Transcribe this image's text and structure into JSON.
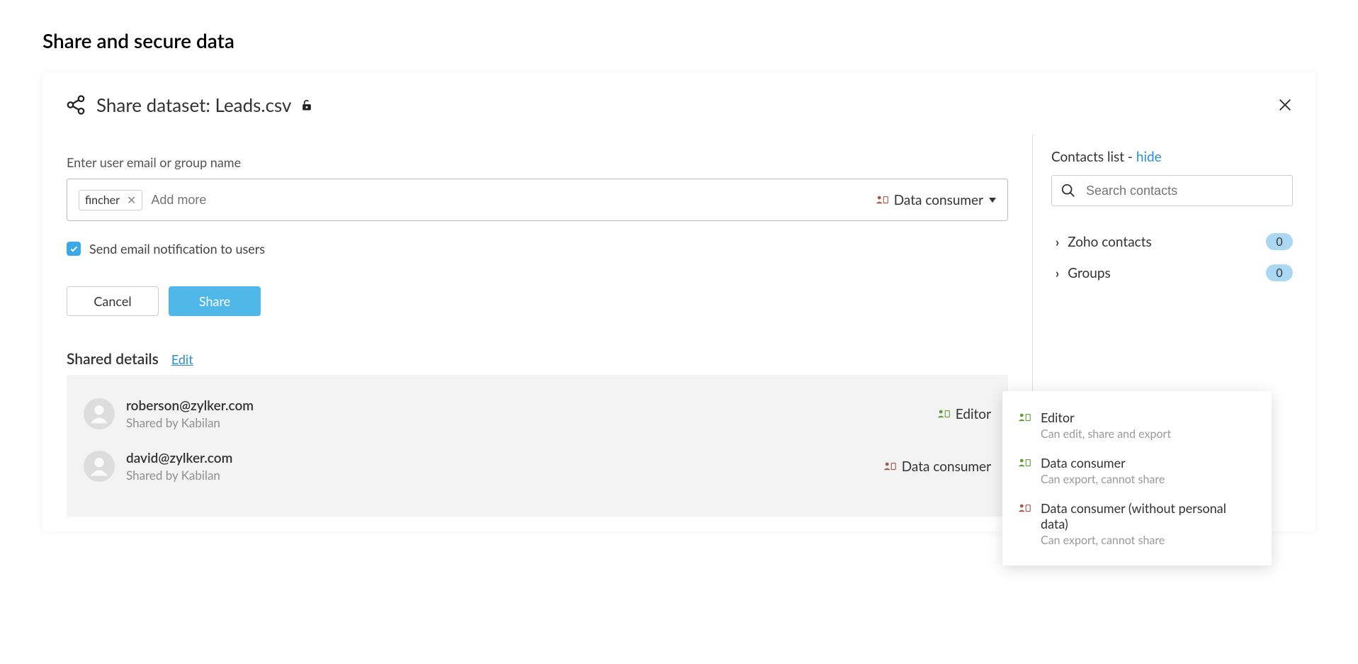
{
  "page": {
    "title": "Share and secure data"
  },
  "modal": {
    "title": "Share dataset: Leads.csv"
  },
  "form": {
    "userFieldLabel": "Enter user email or group name",
    "chip": "fincher",
    "addMorePlaceholder": "Add more",
    "selectedRole": "Data consumer",
    "notifyLabel": "Send email notification to users",
    "cancelLabel": "Cancel",
    "shareLabel": "Share"
  },
  "shared": {
    "headerTitle": "Shared details",
    "editLabel": "Edit",
    "items": [
      {
        "email": "roberson@zylker.com",
        "sharedBy": "Shared by Kabilan",
        "role": "Editor",
        "roleColor": "#6a9b3a"
      },
      {
        "email": "david@zylker.com",
        "sharedBy": "Shared by Kabilan",
        "role": "Data consumer",
        "roleColor": "#a55a4a"
      }
    ]
  },
  "contacts": {
    "headerPrefix": "Contacts list - ",
    "hideLabel": "hide",
    "searchPlaceholder": "Search contacts",
    "groups": [
      {
        "label": "Zoho contacts",
        "count": "0"
      },
      {
        "label": "Groups",
        "count": "0"
      }
    ]
  },
  "roleDropdown": {
    "options": [
      {
        "name": "Editor",
        "desc": "Can edit, share and export",
        "color": "#6a9b3a"
      },
      {
        "name": "Data consumer",
        "desc": "Can export, cannot share",
        "color": "#6a9b3a"
      },
      {
        "name": "Data consumer (without personal data)",
        "desc": "Can export, cannot share",
        "color": "#a55a4a"
      }
    ]
  }
}
